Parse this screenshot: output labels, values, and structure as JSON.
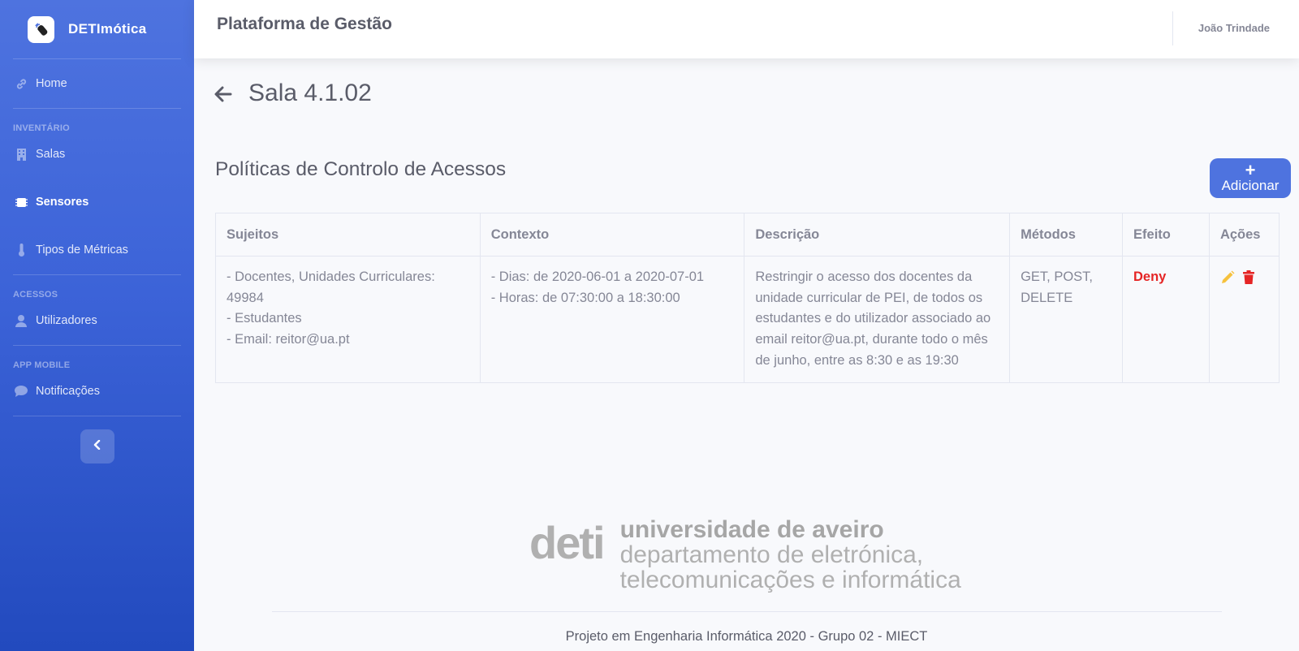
{
  "brand": {
    "name": "DETImótica",
    "logo_icon": "remote-icon"
  },
  "sidebar": {
    "items": [
      {
        "label": "Home",
        "icon": "link-icon"
      },
      {
        "label": "Salas",
        "icon": "building-icon"
      },
      {
        "label": "Sensores",
        "icon": "chip-icon"
      },
      {
        "label": "Tipos de Métricas",
        "icon": "thermometer-icon"
      },
      {
        "label": "Utilizadores",
        "icon": "user-icon"
      },
      {
        "label": "Notificações",
        "icon": "comment-icon"
      }
    ],
    "headings": [
      "Inventário",
      "Acessos",
      "App Mobile"
    ],
    "active": "Sensores"
  },
  "topbar": {
    "title": "Plataforma de Gestão",
    "user": "João Trindade"
  },
  "page": {
    "title": "Sala 4.1.02",
    "section_title": "Políticas de Controlo de Acessos",
    "add_label": "Adicionar",
    "add_icon": "plus-icon"
  },
  "table": {
    "headers": [
      "Sujeitos",
      "Contexto",
      "Descrição",
      "Métodos",
      "Efeito",
      "Ações"
    ],
    "rows": [
      {
        "subjects": [
          "- Docentes, Unidades Curriculares: 49984",
          "- Estudantes",
          "- Email: reitor@ua.pt"
        ],
        "context": [
          "- Dias: de 2020-06-01 a 2020-07-01",
          "- Horas: de 07:30:00 a 18:30:00"
        ],
        "description": "Restringir o acesso dos docentes da unidade curricular de PEI, de todos os estudantes e do utilizador associado ao email reitor@ua.pt, durante todo o mês de junho, entre as 8:30 e as 19:30",
        "methods": "GET, POST, DELETE",
        "effect": "Deny"
      }
    ]
  },
  "footer": {
    "logo_mark": "deti",
    "logo_line1": "universidade de aveiro",
    "logo_line2": "departamento de eletrónica,",
    "logo_line3": "telecomunicações e informática",
    "text": "Projeto em Engenharia Informática 2020 - Grupo 02 - MIECT"
  },
  "colors": {
    "primary": "#4e73df",
    "deny": "#e52525",
    "edit": "#f6c23e",
    "delete": "#e74a3b"
  }
}
